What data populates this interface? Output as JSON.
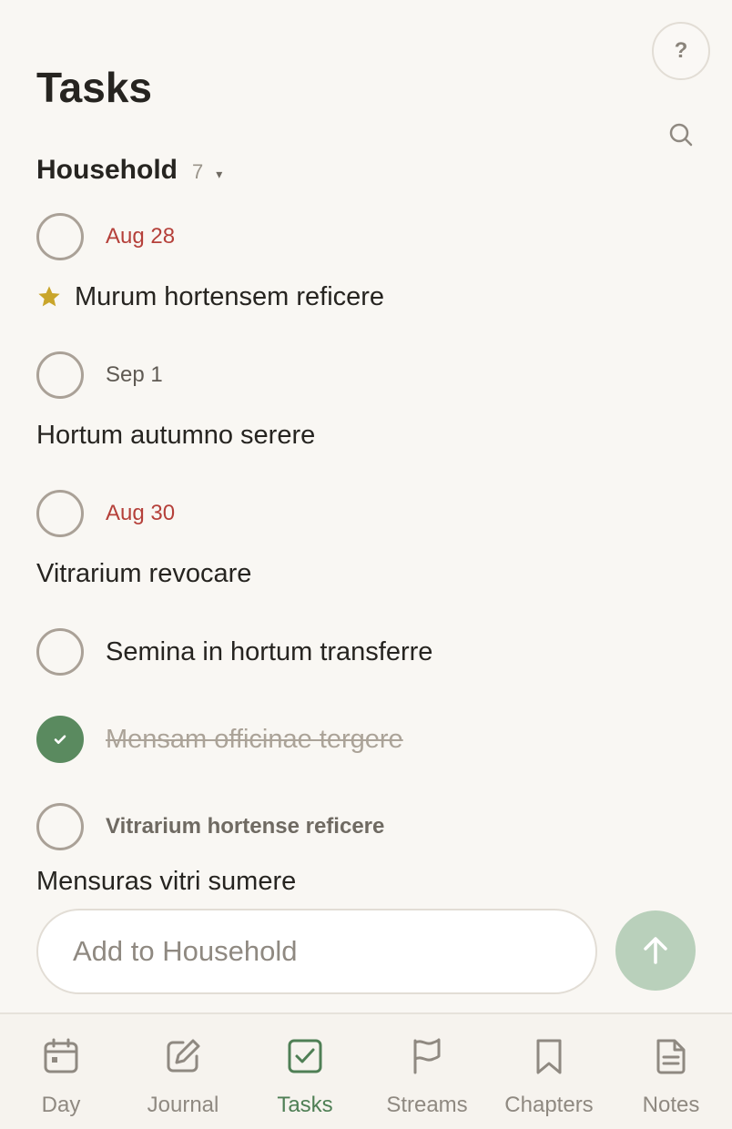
{
  "header": {
    "title": "Tasks",
    "help_label": "?"
  },
  "group": {
    "name": "Household",
    "count": "7",
    "caret": "▾"
  },
  "tasks": [
    {
      "due": "Aug 28",
      "overdue": true,
      "starred": true,
      "title": "Murum hortensem reficere"
    },
    {
      "due": "Sep 1",
      "overdue": false,
      "starred": false,
      "title": "Hortum autumno serere"
    },
    {
      "due": "Aug 30",
      "overdue": true,
      "starred": false,
      "title": "Vitrarium revocare"
    },
    {
      "title": "Semina in hortum transferre"
    },
    {
      "title": "Mensam officinae tergere",
      "completed": true
    },
    {
      "project": "Vitrarium hortense reficere",
      "title": "Mensuras vitri sumere"
    }
  ],
  "composer": {
    "placeholder": "Add to Household"
  },
  "tabs": [
    {
      "label": "Day",
      "icon": "calendar-icon"
    },
    {
      "label": "Journal",
      "icon": "edit-icon"
    },
    {
      "label": "Tasks",
      "icon": "checkbox-icon",
      "active": true
    },
    {
      "label": "Streams",
      "icon": "flag-icon"
    },
    {
      "label": "Chapters",
      "icon": "bookmark-icon"
    },
    {
      "label": "Notes",
      "icon": "document-icon"
    }
  ],
  "colors": {
    "background": "#f9f7f3",
    "accent_green": "#5a8a5f",
    "overdue_red": "#b5403a",
    "star_gold": "#c9a52a"
  }
}
